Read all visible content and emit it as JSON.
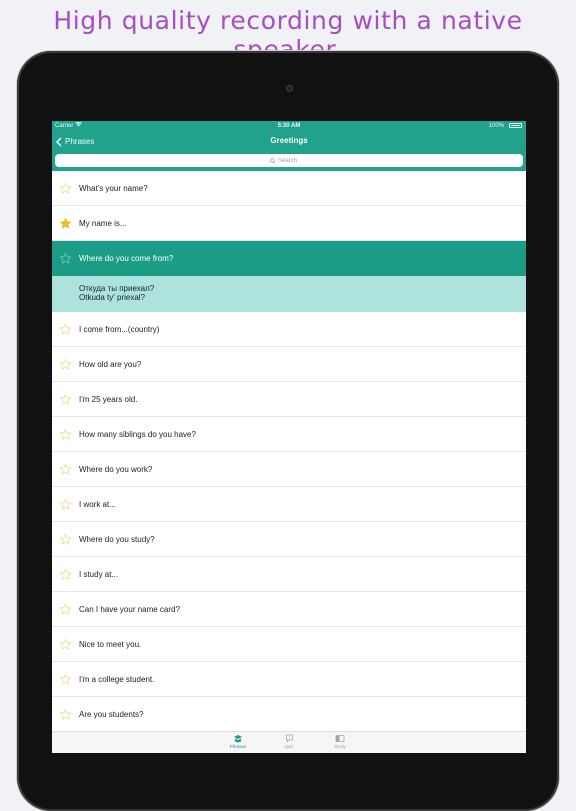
{
  "headline": "High quality recording with a native speaker.",
  "status_bar": {
    "carrier": "Carrier",
    "time": "5:30 AM",
    "battery": "100%"
  },
  "nav": {
    "back_label": "Phrases",
    "title": "Greetings"
  },
  "search": {
    "placeholder": "Search"
  },
  "colors": {
    "accent": "#20a28d",
    "selected_row": "#1a9c86",
    "translation_bg": "#aee2dc",
    "headline": "#a54fc0",
    "star_gold": "#f2c21b",
    "star_outline": "#f0d77a"
  },
  "phrases": {
    "row1": {
      "text": "What's your name?",
      "starred": false
    },
    "row2": {
      "text": "My name is...",
      "starred": true
    },
    "row3": {
      "text": "Where do you come from?",
      "starred": false,
      "selected": true
    },
    "translation": {
      "native": "Откуда ты приехал?",
      "romanized": "Otkuda ty' priexal?"
    },
    "row4": {
      "text": "I come from...(country)",
      "starred": false
    },
    "row5": {
      "text": "How old are you?",
      "starred": false
    },
    "row6": {
      "text": "I'm 25 years old.",
      "starred": false
    },
    "row7": {
      "text": "How many siblings do you have?",
      "starred": false
    },
    "row8": {
      "text": "Where do you work?",
      "starred": false
    },
    "row9": {
      "text": "I work at...",
      "starred": false
    },
    "row10": {
      "text": "Where do you study?",
      "starred": false
    },
    "row11": {
      "text": "I study at...",
      "starred": false
    },
    "row12": {
      "text": "Can I have your name card?",
      "starred": false
    },
    "row13": {
      "text": "Nice to meet you.",
      "starred": false
    },
    "row14": {
      "text": "I'm a college student.",
      "starred": false
    },
    "row15": {
      "text": "Are you students?",
      "starred": false
    }
  },
  "tabs": {
    "phrases": "Phrases",
    "quiz": "Quiz",
    "study": "Study",
    "active": "Phrases"
  }
}
